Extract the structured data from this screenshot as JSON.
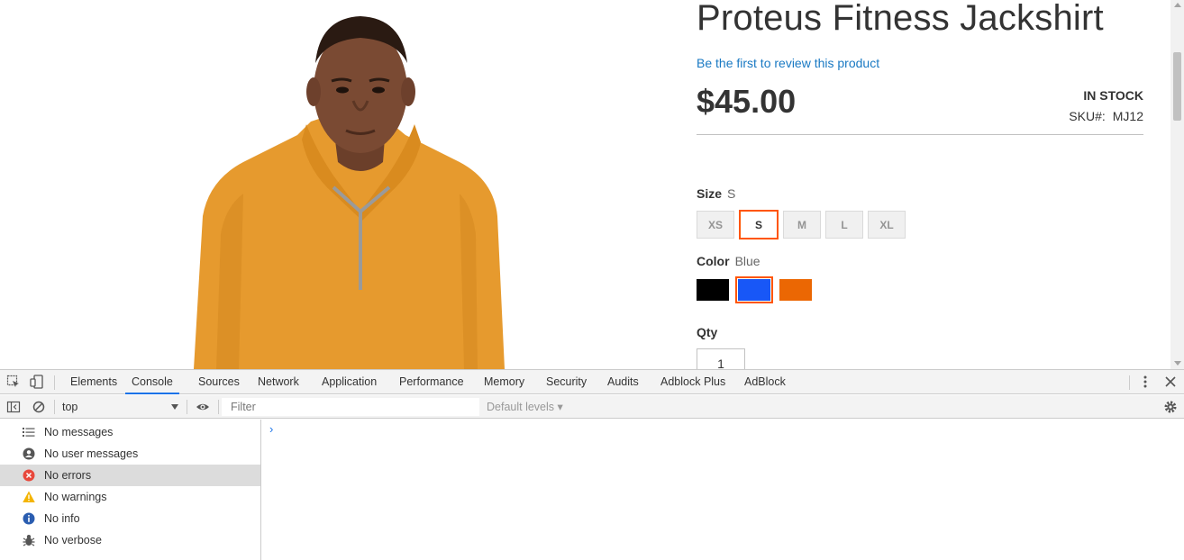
{
  "product": {
    "name": "Proteus Fitness Jackshirt",
    "review_link": "Be the first to review this product",
    "price": "$45.00",
    "stock": "IN STOCK",
    "sku_label": "SKU#:",
    "sku": "MJ12",
    "size": {
      "label": "Size",
      "selected": "S",
      "options": [
        "XS",
        "S",
        "M",
        "L",
        "XL"
      ]
    },
    "color": {
      "label": "Color",
      "selected": "Blue",
      "options": [
        {
          "name": "black-swatch",
          "hex": "#000000"
        },
        {
          "name": "blue-swatch",
          "hex": "#1857f7"
        },
        {
          "name": "orange-swatch",
          "hex": "#eb6703"
        }
      ]
    },
    "qty_label": "Qty",
    "qty_value": "1",
    "image_colors": {
      "shirt": "#e69a2e",
      "skin": "#7a4a33"
    }
  },
  "devtools": {
    "tabs": [
      "Elements",
      "Console",
      "Sources",
      "Network",
      "Application",
      "Performance",
      "Memory",
      "Security",
      "Audits",
      "Adblock Plus",
      "AdBlock"
    ],
    "active_tab": "Console",
    "context": "top",
    "filter_placeholder": "Filter",
    "levels": "Default levels ▾",
    "sidebar": [
      {
        "label": "No messages",
        "icon": "list-icon"
      },
      {
        "label": "No user messages",
        "icon": "user-icon"
      },
      {
        "label": "No errors",
        "icon": "error-icon"
      },
      {
        "label": "No warnings",
        "icon": "warning-icon"
      },
      {
        "label": "No info",
        "icon": "info-icon"
      },
      {
        "label": "No verbose",
        "icon": "bug-icon"
      }
    ],
    "active_sidebar": "No errors",
    "accent": "#1a73e8"
  }
}
